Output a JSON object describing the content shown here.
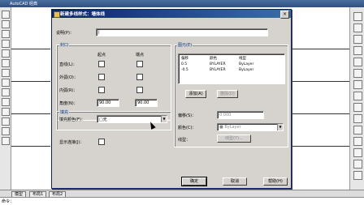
{
  "app": {
    "title": "AutoCAD 经典"
  },
  "tabs": [
    "模型",
    "布局1",
    "布局2"
  ],
  "command": {
    "prompt": "命令："
  },
  "dialog": {
    "title": "新建多线样式：墙体线",
    "close_label": "×",
    "description_label": "说明(P)：",
    "description_value": "|",
    "caps": {
      "title": "封口",
      "start_header": "起点",
      "end_header": "端点",
      "rows": [
        {
          "label": "直线(L)："
        },
        {
          "label": "外弧(O)："
        },
        {
          "label": "内弧(R)："
        }
      ],
      "angle_label": "角度(N)：",
      "angle_start": "90.00",
      "angle_end": "90.00"
    },
    "fill": {
      "title": "填充",
      "color_label": "填充颜色(F)：",
      "color_value": "□无"
    },
    "joints": {
      "label": "显示连接(J)："
    },
    "elements": {
      "title": "图元(E)",
      "headers": [
        "偏移",
        "颜色",
        "线型"
      ],
      "rows": [
        {
          "offset": "0.5",
          "color": "BYLAYER",
          "linetype": "ByLayer"
        },
        {
          "offset": "-0.5",
          "color": "BYLAYER",
          "linetype": "ByLayer"
        }
      ],
      "add_label": "添加(A)",
      "delete_label": "删除(D)",
      "offset_label": "偏移(S)：",
      "offset_value": "0.000",
      "color_label": "颜色(C)：",
      "color_value": "■ ByLayer",
      "linetype_label": "线型：",
      "linetype_button": "线型(Y)..."
    },
    "buttons": {
      "ok": "确定",
      "cancel": "取消",
      "help": "帮助(H)"
    }
  }
}
